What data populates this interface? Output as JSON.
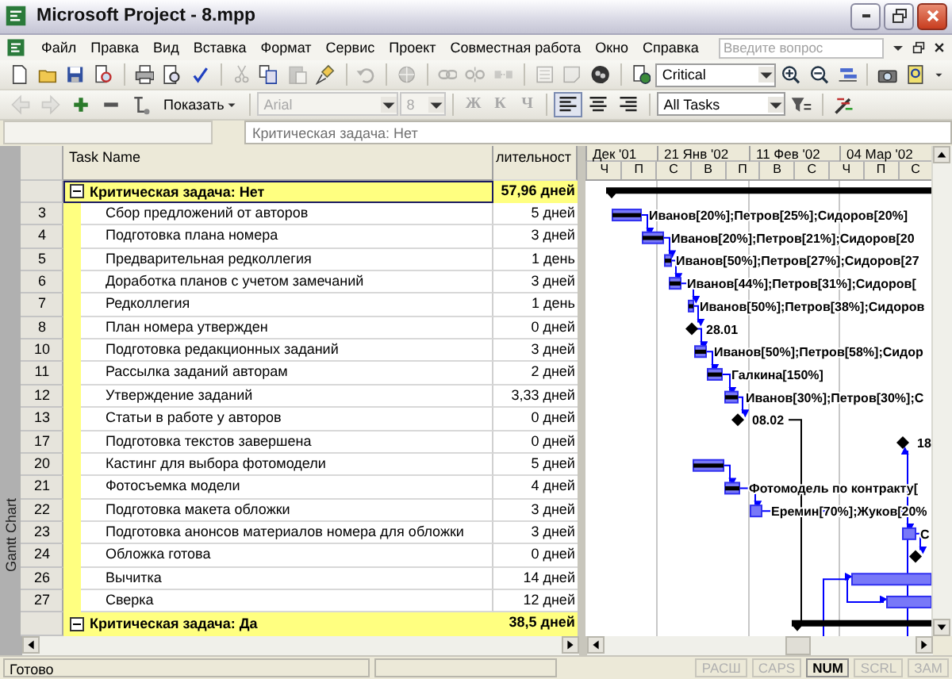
{
  "window": {
    "title": "Microsoft Project - 8.mpp"
  },
  "menu": [
    {
      "label": "Файл"
    },
    {
      "label": "Правка"
    },
    {
      "label": "Вид"
    },
    {
      "label": "Вставка"
    },
    {
      "label": "Формат"
    },
    {
      "label": "Сервис"
    },
    {
      "label": "Проект"
    },
    {
      "label": "Совместная работа"
    },
    {
      "label": "Окно"
    },
    {
      "label": "Справка"
    }
  ],
  "help_search": {
    "placeholder": "Введите вопрос"
  },
  "toolbar_1": [
    {
      "kind": "button",
      "disabled": false
    },
    {
      "kind": "button",
      "disabled": false
    },
    {
      "kind": "button",
      "disabled": false
    },
    {
      "kind": "button",
      "disabled": false
    },
    {
      "kind": "separator"
    },
    {
      "kind": "button",
      "disabled": false
    },
    {
      "kind": "button",
      "disabled": false
    },
    {
      "kind": "button",
      "disabled": false
    },
    {
      "kind": "separator"
    },
    {
      "kind": "button",
      "disabled": true
    },
    {
      "kind": "button",
      "disabled": false
    },
    {
      "kind": "button",
      "disabled": true
    },
    {
      "kind": "button",
      "disabled": false
    },
    {
      "kind": "separator"
    },
    {
      "kind": "button",
      "disabled": true
    },
    {
      "kind": "separator"
    },
    {
      "kind": "button",
      "disabled": true
    },
    {
      "kind": "separator"
    },
    {
      "kind": "button",
      "disabled": true
    },
    {
      "kind": "button",
      "disabled": true
    },
    {
      "kind": "button",
      "disabled": true
    },
    {
      "kind": "separator"
    },
    {
      "kind": "button",
      "disabled": true
    },
    {
      "kind": "button",
      "disabled": true
    },
    {
      "kind": "button",
      "disabled": false
    },
    {
      "kind": "separator"
    },
    {
      "kind": "button",
      "disabled": false
    },
    {
      "kind": "dropdown",
      "value": "Critical",
      "disabled": false
    },
    {
      "kind": "button",
      "disabled": false
    },
    {
      "kind": "button",
      "disabled": false
    },
    {
      "kind": "button",
      "disabled": false
    },
    {
      "kind": "separator"
    },
    {
      "kind": "button",
      "disabled": false
    },
    {
      "kind": "button",
      "disabled": false
    },
    {
      "kind": "button",
      "disabled": false
    }
  ],
  "toolbar_2": [
    {
      "kind": "button",
      "disabled": true
    },
    {
      "kind": "button",
      "disabled": true
    },
    {
      "kind": "button",
      "disabled": false
    },
    {
      "kind": "button",
      "disabled": false
    },
    {
      "kind": "button",
      "disabled": false
    },
    {
      "kind": "menu-button",
      "label": "Показать",
      "disabled": false
    },
    {
      "kind": "separator"
    },
    {
      "kind": "dropdown",
      "value": "Arial",
      "disabled": true
    },
    {
      "kind": "dropdown",
      "value": "8",
      "disabled": true
    },
    {
      "kind": "separator"
    },
    {
      "kind": "text-button",
      "label": "Ж",
      "disabled": true
    },
    {
      "kind": "text-button",
      "label": "К",
      "disabled": true
    },
    {
      "kind": "text-button",
      "label": "Ч",
      "disabled": true
    },
    {
      "kind": "separator"
    },
    {
      "kind": "button",
      "disabled": false,
      "pressed": true
    },
    {
      "kind": "button",
      "disabled": false,
      "pressed": false
    },
    {
      "kind": "button",
      "disabled": false,
      "pressed": false
    },
    {
      "kind": "separator"
    },
    {
      "kind": "dropdown",
      "value": "All Tasks",
      "disabled": false
    },
    {
      "kind": "button",
      "disabled": false
    },
    {
      "kind": "separator"
    },
    {
      "kind": "button",
      "disabled": false
    }
  ],
  "entry_bar": {
    "value": "Критическая задача: Нет",
    "disabled": true
  },
  "view_bar": {
    "label": "Gantt Chart"
  },
  "table": {
    "columns": [
      "Task Name",
      "лительност"
    ],
    "rows": [
      {
        "kind": "group",
        "expanded": true,
        "selected": true,
        "name": "Критическая задача: Нет",
        "duration": "57,96 дней"
      },
      {
        "kind": "task",
        "id": "3",
        "selected": false,
        "name": "Сбор предложений от авторов",
        "duration": "5 дней",
        "bar_label": "Иванов[20%];Петров[25%];Сидоров[20%]"
      },
      {
        "kind": "task",
        "id": "4",
        "selected": false,
        "name": "Подготовка плана номера",
        "duration": "3 дней",
        "bar_label": "Иванов[20%];Петров[21%];Сидоров[20"
      },
      {
        "kind": "task",
        "id": "5",
        "selected": false,
        "name": "Предварительная редколлегия",
        "duration": "1 день",
        "bar_label": "Иванов[50%];Петров[27%];Сидоров[27"
      },
      {
        "kind": "task",
        "id": "6",
        "selected": false,
        "name": "Доработка планов с учетом замечаний",
        "duration": "3 дней",
        "bar_label": "Иванов[44%];Петров[31%];Сидоров["
      },
      {
        "kind": "task",
        "id": "7",
        "selected": false,
        "name": "Редколлегия",
        "duration": "1 день",
        "bar_label": "Иванов[50%];Петров[38%];Сидоров"
      },
      {
        "kind": "task",
        "id": "8",
        "selected": false,
        "name": "План номера утвержден",
        "duration": "0 дней",
        "bar_label": "28.01"
      },
      {
        "kind": "task",
        "id": "10",
        "selected": false,
        "name": "Подготовка редакционных заданий",
        "duration": "3 дней",
        "bar_label": "Иванов[50%];Петров[58%];Сидор"
      },
      {
        "kind": "task",
        "id": "11",
        "selected": false,
        "name": "Рассылка заданий авторам",
        "duration": "2 дней",
        "bar_label": "Галкина[150%]"
      },
      {
        "kind": "task",
        "id": "12",
        "selected": false,
        "name": "Утверждение заданий",
        "duration": "3,33 дней",
        "bar_label": "Иванов[30%];Петров[30%];С"
      },
      {
        "kind": "task",
        "id": "13",
        "selected": false,
        "name": "Статьи в работе у авторов",
        "duration": "0 дней",
        "bar_label": "08.02"
      },
      {
        "kind": "task",
        "id": "17",
        "selected": false,
        "name": "Подготовка текстов завершена",
        "duration": "0 дней",
        "bar_label": "18"
      },
      {
        "kind": "task",
        "id": "20",
        "selected": false,
        "name": "Кастинг для выбора фотомодели",
        "duration": "5 дней"
      },
      {
        "kind": "task",
        "id": "21",
        "selected": false,
        "name": "Фотосъемка модели",
        "duration": "4 дней",
        "bar_label": "Фотомодель по контракту["
      },
      {
        "kind": "task",
        "id": "22",
        "selected": false,
        "name": "Подготовка макета обложки",
        "duration": "3 дней",
        "bar_label": "Еремин[70%];Жуков[20%"
      },
      {
        "kind": "task",
        "id": "23",
        "selected": false,
        "name": "Подготовка анонсов материалов номера для обложки",
        "duration": "3 дней",
        "bar_label": "С"
      },
      {
        "kind": "task",
        "id": "24",
        "selected": false,
        "name": "Обложка готова",
        "duration": "0 дней"
      },
      {
        "kind": "task",
        "id": "26",
        "selected": false,
        "name": "Вычитка",
        "duration": "14 дней"
      },
      {
        "kind": "task",
        "id": "27",
        "selected": false,
        "name": "Сверка",
        "duration": "12 дней"
      },
      {
        "kind": "group",
        "expanded": true,
        "selected": false,
        "name": "Критическая задача: Да",
        "duration": "38,5 дней"
      }
    ]
  },
  "timescale": {
    "top": [
      "Дек '01",
      "21 Янв '02",
      "11 Фев '02",
      "04 Мар '02"
    ],
    "bottom": [
      "Ч",
      "П",
      "С",
      "В",
      "П",
      "В",
      "С",
      "Ч",
      "П",
      "С"
    ]
  },
  "status_bar": {
    "message": "Готово",
    "indicators": [
      {
        "label": "РАСШ",
        "on": false
      },
      {
        "label": "CAPS",
        "on": false
      },
      {
        "label": "NUM",
        "on": true
      },
      {
        "label": "SCRL",
        "on": false
      },
      {
        "label": "ЗАМ",
        "on": false
      }
    ]
  }
}
